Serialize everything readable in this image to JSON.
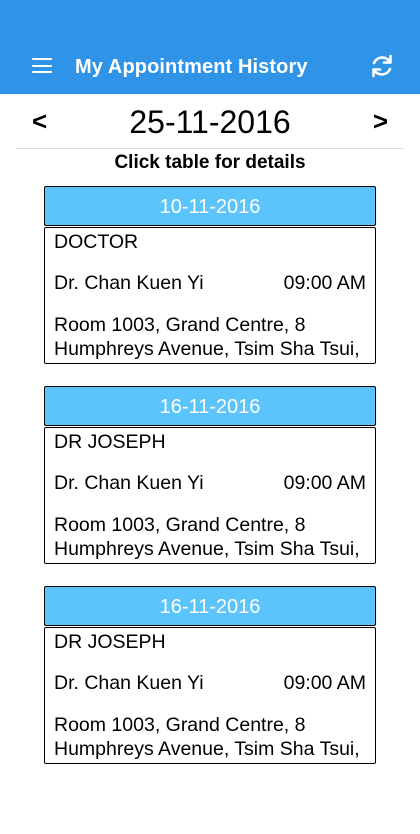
{
  "appbar": {
    "title": "My Appointment History",
    "menu_icon": "menu-icon",
    "refresh_icon": "refresh-icon",
    "color": "#2f94e8"
  },
  "date_nav": {
    "prev": "<",
    "next": ">",
    "current_date": "25-11-2016"
  },
  "hint": "Click table for details",
  "accent": "#5ac4fb",
  "appointments": [
    {
      "date": "10-11-2016",
      "clinic": "DOCTOR",
      "doctor": "Dr. Chan Kuen Yi",
      "time": "09:00 AM",
      "address": "Room 1003, Grand Centre, 8 Humphreys Avenue, Tsim Sha Tsui,"
    },
    {
      "date": "16-11-2016",
      "clinic": "DR JOSEPH",
      "doctor": "Dr. Chan Kuen Yi",
      "time": "09:00 AM",
      "address": "Room 1003, Grand Centre, 8 Humphreys Avenue, Tsim Sha Tsui,"
    },
    {
      "date": "16-11-2016",
      "clinic": "DR JOSEPH",
      "doctor": "Dr. Chan Kuen Yi",
      "time": "09:00 AM",
      "address": "Room 1003, Grand Centre, 8 Humphreys Avenue, Tsim Sha Tsui,"
    }
  ]
}
